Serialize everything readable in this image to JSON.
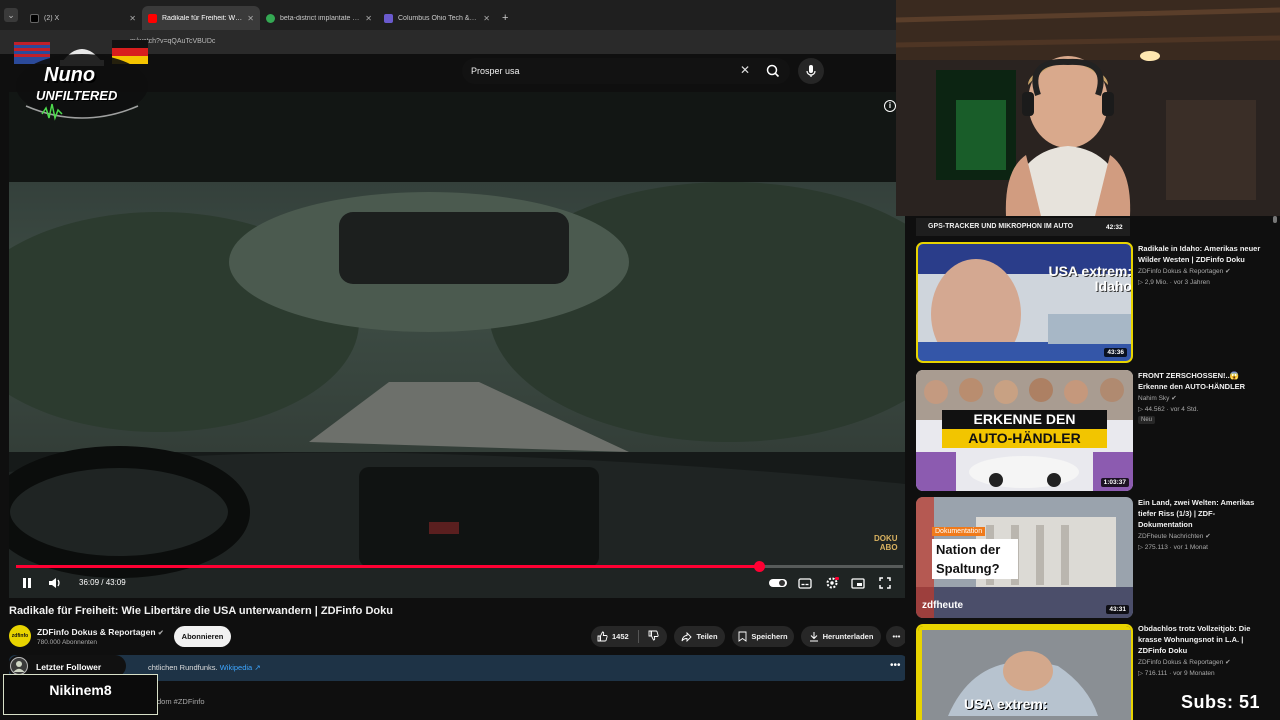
{
  "browser": {
    "tabs": [
      {
        "label": "(2) X",
        "color": "#000000",
        "active": false
      },
      {
        "label": "Radikale für Freiheit: Wie Li",
        "color": "#ff0000",
        "active": true
      },
      {
        "label": "beta-district implantate usa - G",
        "color": "#34a853",
        "active": false
      },
      {
        "label": "Columbus Ohio Tech & Innova",
        "color": "#6a5acd",
        "active": false
      }
    ],
    "url": "m/watch?v=qQAuTcVBUDc"
  },
  "search": {
    "query": "Prosper usa"
  },
  "overlay": {
    "logo_line1": "Nuno",
    "logo_line2": "UNFILTERED",
    "follower_label": "Letzter Follower",
    "follower_name": "Nikinem8",
    "subs_counter": "Subs: 51"
  },
  "player": {
    "time": "36:09 / 43:09",
    "progress": 0.838,
    "watermark_line1": "DOKU",
    "watermark_line2": "ABO",
    "info_icon": "info-icon"
  },
  "video": {
    "title": "Radikale für Freiheit: Wie Libertäre die USA unterwandern | ZDFinfo Doku",
    "channel": "ZDFinfo Dokus & Reportagen",
    "subscribers": "780.000 Abonnenten",
    "subscribe_label": "Abonnieren",
    "likes": "1452",
    "share_label": "Teilen",
    "save_label": "Speichern",
    "download_label": "Herunterladen",
    "description_partial": "chtlichen Rundfunks.",
    "description_link": "Wikipedia ↗",
    "hashtag_line": "dom #ZDFinfo"
  },
  "sidebar": {
    "top_item": {
      "text": "GPS-TRACKER UND MIKROPHON IM AUTO",
      "duration": "42:32"
    },
    "items": [
      {
        "title": "Radikale in Idaho: Amerikas neuer Wilder Westen | ZDFinfo Doku",
        "channel": "ZDFinfo Dokus & Reportagen ✔",
        "meta": "▷ 2,9 Mio. · vor 3 Jahren",
        "duration": "43:36",
        "thumb_text": "USA extrem: Idaho",
        "badge": ""
      },
      {
        "title": "FRONT ZERSCHOSSEN!..😱 Erkenne den AUTO-HÄNDLER",
        "channel": "Nahim Sky ✔",
        "meta": "▷ 44.562 · vor 4 Std.",
        "duration": "1:03:37",
        "thumb_text": "ERKENNE DEN AUTO-HÄNDLER",
        "badge": "Neu"
      },
      {
        "title": "Ein Land, zwei Welten: Amerikas tiefer Riss (1/3) | ZDF-Dokumentation",
        "channel": "ZDFheute Nachrichten ✔",
        "meta": "▷ 275.113 · vor 1 Monat",
        "duration": "43:31",
        "thumb_text": "Nation der Spaltung?",
        "badge": ""
      },
      {
        "title": "Obdachlos trotz Vollzeitjob: Die krasse Wohnungsnot in L.A. | ZDFinfo Doku",
        "channel": "ZDFinfo Dokus & Reportagen ✔",
        "meta": "▷ 716.111 · vor 9 Monaten",
        "duration": "",
        "thumb_text": "USA extrem:",
        "badge": ""
      }
    ]
  },
  "colors": {
    "accent": "#ff0033",
    "zdf_yellow": "#e8d400",
    "link": "#3ea6ff"
  }
}
